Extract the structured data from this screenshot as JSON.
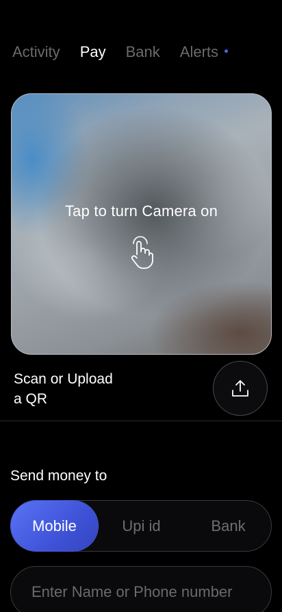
{
  "tabs": [
    {
      "label": "Activity",
      "active": false
    },
    {
      "label": "Pay",
      "active": true
    },
    {
      "label": "Bank",
      "active": false
    },
    {
      "label": "Alerts",
      "active": false,
      "has_dot": true
    }
  ],
  "camera": {
    "prompt": "Tap to turn Camera on",
    "icon": "tap-hand-icon"
  },
  "scan": {
    "label_line1": "Scan or Upload",
    "label_line2": "a QR",
    "upload_icon": "upload-icon"
  },
  "send": {
    "label": "Send money to",
    "options": [
      {
        "label": "Mobile",
        "active": true
      },
      {
        "label": "Upi id",
        "active": false
      },
      {
        "label": "Bank",
        "active": false
      }
    ],
    "input_placeholder": "Enter Name or Phone number",
    "input_value": ""
  },
  "colors": {
    "background": "#000000",
    "accent": "#4b63e8",
    "inactive_text": "#6b6b6f"
  }
}
